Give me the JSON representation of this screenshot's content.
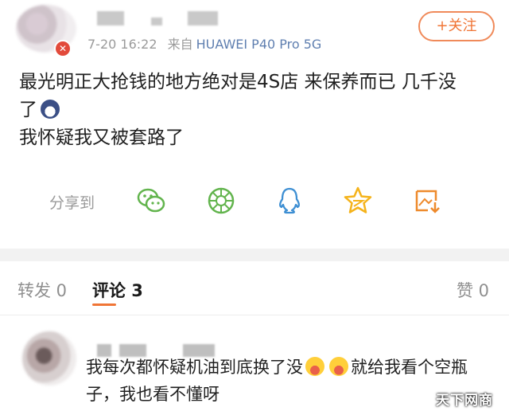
{
  "post": {
    "timestamp": "7-20 16:22",
    "source_prefix": "来自",
    "device": "HUAWEI P40 Pro 5G",
    "follow_label": "+关注",
    "text_line1": "最光明正大抢钱的地方绝对是4S店 来保养而已 几千没",
    "text_line2": "了",
    "text_line3": "我怀疑我又被套路了"
  },
  "share": {
    "label": "分享到",
    "icons": [
      "wechat-icon",
      "moments-icon",
      "qq-icon",
      "qzone-icon",
      "save-image-icon"
    ]
  },
  "tabs": {
    "repost": "转发 0",
    "comment": "评论 3",
    "like": "赞 0"
  },
  "comment": {
    "text_part1": "我每次都怀疑机油到底换了没",
    "text_part2": "就给我看个空瓶子，我也看不懂呀"
  },
  "watermark": "天下网商",
  "colors": {
    "accent": "#f07536",
    "device_link": "#5f7fb0",
    "share_green": "#62b44d",
    "share_blue": "#3e8fd3",
    "share_yellow": "#f5b31b",
    "share_orange": "#ee8a2c"
  }
}
